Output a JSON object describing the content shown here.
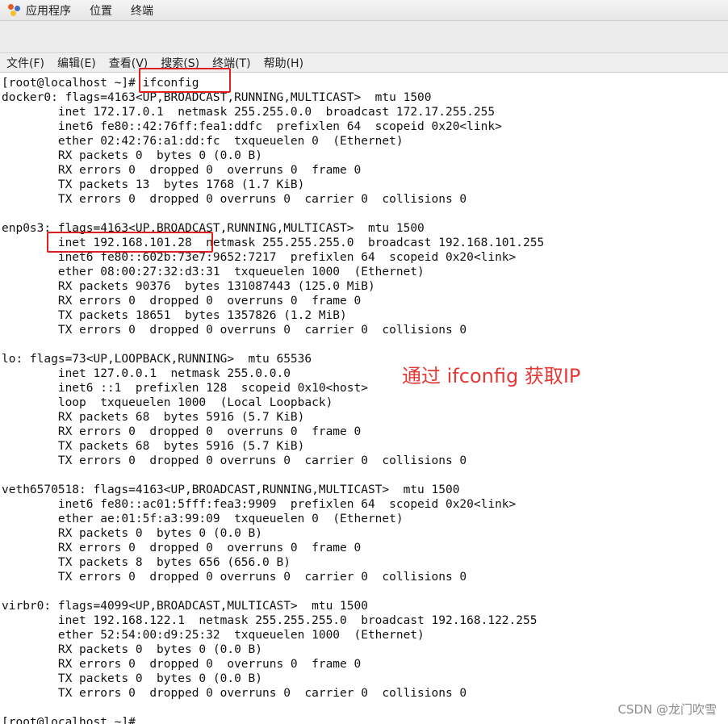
{
  "topbar": {
    "items": [
      "应用程序",
      "位置",
      "终端"
    ]
  },
  "menubar": {
    "items": [
      "文件(F)",
      "编辑(E)",
      "查看(V)",
      "搜索(S)",
      "终端(T)",
      "帮助(H)"
    ]
  },
  "terminal": {
    "lines": [
      "[root@localhost ~]# ifconfig",
      "docker0: flags=4163<UP,BROADCAST,RUNNING,MULTICAST>  mtu 1500",
      "        inet 172.17.0.1  netmask 255.255.0.0  broadcast 172.17.255.255",
      "        inet6 fe80::42:76ff:fea1:ddfc  prefixlen 64  scopeid 0x20<link>",
      "        ether 02:42:76:a1:dd:fc  txqueuelen 0  (Ethernet)",
      "        RX packets 0  bytes 0 (0.0 B)",
      "        RX errors 0  dropped 0  overruns 0  frame 0",
      "        TX packets 13  bytes 1768 (1.7 KiB)",
      "        TX errors 0  dropped 0 overruns 0  carrier 0  collisions 0",
      "",
      "enp0s3: flags=4163<UP,BROADCAST,RUNNING,MULTICAST>  mtu 1500",
      "        inet 192.168.101.28  netmask 255.255.255.0  broadcast 192.168.101.255",
      "        inet6 fe80::602b:73e7:9652:7217  prefixlen 64  scopeid 0x20<link>",
      "        ether 08:00:27:32:d3:31  txqueuelen 1000  (Ethernet)",
      "        RX packets 90376  bytes 131087443 (125.0 MiB)",
      "        RX errors 0  dropped 0  overruns 0  frame 0",
      "        TX packets 18651  bytes 1357826 (1.2 MiB)",
      "        TX errors 0  dropped 0 overruns 0  carrier 0  collisions 0",
      "",
      "lo: flags=73<UP,LOOPBACK,RUNNING>  mtu 65536",
      "        inet 127.0.0.1  netmask 255.0.0.0",
      "        inet6 ::1  prefixlen 128  scopeid 0x10<host>",
      "        loop  txqueuelen 1000  (Local Loopback)",
      "        RX packets 68  bytes 5916 (5.7 KiB)",
      "        RX errors 0  dropped 0  overruns 0  frame 0",
      "        TX packets 68  bytes 5916 (5.7 KiB)",
      "        TX errors 0  dropped 0 overruns 0  carrier 0  collisions 0",
      "",
      "veth6570518: flags=4163<UP,BROADCAST,RUNNING,MULTICAST>  mtu 1500",
      "        inet6 fe80::ac01:5fff:fea3:9909  prefixlen 64  scopeid 0x20<link>",
      "        ether ae:01:5f:a3:99:09  txqueuelen 0  (Ethernet)",
      "        RX packets 0  bytes 0 (0.0 B)",
      "        RX errors 0  dropped 0  overruns 0  frame 0",
      "        TX packets 8  bytes 656 (656.0 B)",
      "        TX errors 0  dropped 0 overruns 0  carrier 0  collisions 0",
      "",
      "virbr0: flags=4099<UP,BROADCAST,MULTICAST>  mtu 1500",
      "        inet 192.168.122.1  netmask 255.255.255.0  broadcast 192.168.122.255",
      "        ether 52:54:00:d9:25:32  txqueuelen 1000  (Ethernet)",
      "        RX packets 0  bytes 0 (0.0 B)",
      "        RX errors 0  dropped 0  overruns 0  frame 0",
      "        TX packets 0  bytes 0 (0.0 B)",
      "        TX errors 0  dropped 0 overruns 0  carrier 0  collisions 0",
      "",
      "[root@localhost ~]#"
    ]
  },
  "annotation": {
    "text": "通过 ifconfig 获取IP"
  },
  "watermark": {
    "text": "CSDN @龙门吹雪"
  },
  "colors": {
    "annotation": "#e53935",
    "highlight_box": "#e02020"
  }
}
